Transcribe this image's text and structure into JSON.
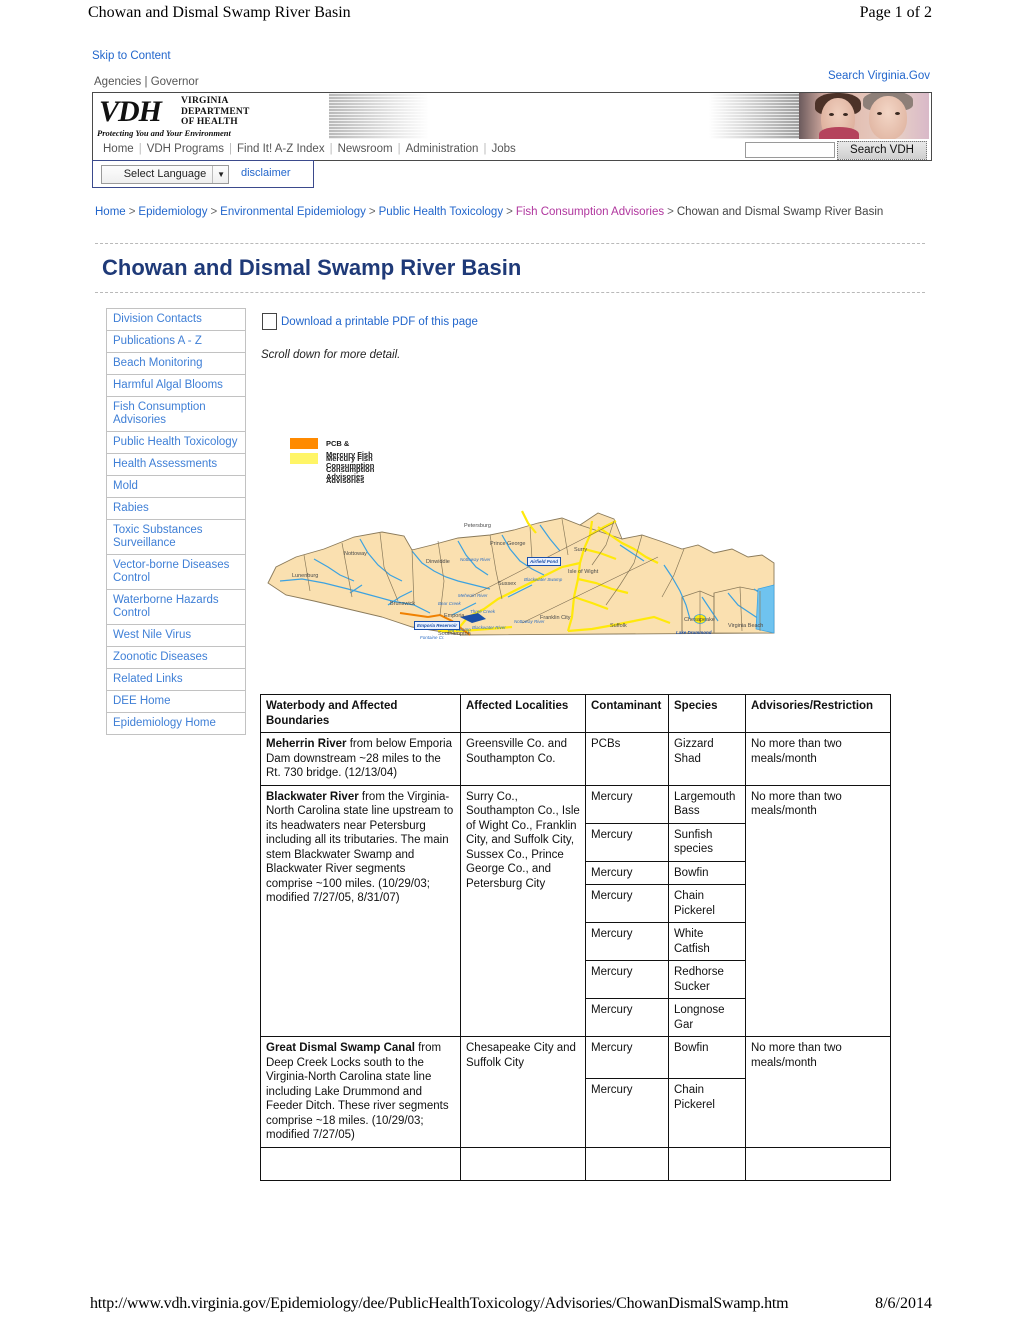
{
  "print": {
    "header_title": "Chowan and Dismal Swamp River Basin",
    "page_indicator": "Page 1 of 2",
    "footer_url": "http://www.vdh.virginia.gov/Epidemiology/dee/PublicHealthToxicology/Advisories/ChowanDismalSwamp.htm",
    "footer_date": "8/6/2014"
  },
  "topbar": {
    "skip_to_content": "Skip to Content",
    "search_virginia": "Search Virginia.Gov",
    "agencies": "Agencies",
    "separator": "|",
    "governor": "Governor"
  },
  "banner": {
    "logo_mark": "VDH",
    "logo_line1": "VIRGINIA",
    "logo_line2": "DEPARTMENT",
    "logo_line3": "OF HEALTH",
    "tagline": "Protecting You and Your Environment"
  },
  "nav": {
    "items": [
      "Home",
      "VDH Programs",
      "Find It! A-Z Index",
      "Newsroom",
      "Administration",
      "Jobs"
    ],
    "search_placeholder": "",
    "search_button": "Search VDH"
  },
  "language": {
    "select_label": "Select Language",
    "caret": "▼",
    "disclaimer": "disclaimer"
  },
  "breadcrumb": {
    "items": [
      {
        "label": "Home",
        "state": "link"
      },
      {
        "label": "Epidemiology",
        "state": "link"
      },
      {
        "label": "Environmental Epidemiology",
        "state": "link"
      },
      {
        "label": "Public Health Toxicology",
        "state": "link"
      },
      {
        "label": "Fish Consumption Advisories",
        "state": "visited"
      },
      {
        "label": "Chowan and Dismal Swamp River Basin",
        "state": "current"
      }
    ],
    "separator": ">"
  },
  "page_title": "Chowan and Dismal Swamp River Basin",
  "sidebar": {
    "items": [
      "Division Contacts",
      "Publications A - Z",
      "Beach Monitoring",
      "Harmful Algal Blooms",
      "Fish Consumption Advisories",
      "Public Health Toxicology",
      "Health Assessments",
      "Mold",
      "Rabies",
      "Toxic Substances Surveillance",
      "Vector-borne Diseases Control",
      "Waterborne Hazards Control",
      "West Nile Virus",
      "Zoonotic Diseases",
      "Related Links",
      "DEE Home",
      "Epidemiology Home"
    ]
  },
  "content": {
    "pdf_link": "Download a printable PDF of this page",
    "scroll_note": "Scroll down for more detail."
  },
  "map": {
    "legend": [
      {
        "color": "#FF8A00",
        "label": "PCB & Mercury Fish Consumption Advisories"
      },
      {
        "color": "#FFF566",
        "label": "Mercury Fish Consumption Advisories"
      }
    ],
    "county_labels": [
      "Lunenburg",
      "Nottoway",
      "Dinwiddie",
      "Brunswick",
      "Emporia",
      "Petersburg",
      "Prince George",
      "Sussex",
      "Surry",
      "Isle of Wight",
      "Franklin City",
      "Southampton",
      "Suffolk",
      "Chesapeake",
      "Virginia Beach"
    ],
    "water_labels": [
      "Nottoway River",
      "Meherrin River",
      "Blackwater River",
      "Bear Creek",
      "Three Creek",
      "Big Swamp",
      "Fontaine Cr.",
      "Nottoway River",
      "Blackwater Swamp"
    ],
    "boxed_labels": [
      "Emporia Reservoir",
      "Airfield Pond",
      "Lake Drummond"
    ],
    "colors": {
      "land": "#FAE0B0",
      "water_blue": "#3CA2E0",
      "advisory_yellow": "#FFE90A",
      "advisory_orange": "#F08000",
      "border": "#8a7a5a"
    }
  },
  "table": {
    "columns": [
      "Waterbody and Affected Boundaries",
      "Affected Localities",
      "Contaminant",
      "Species",
      "Advisories/Restriction"
    ],
    "rows": [
      {
        "waterbody_name": "Meherrin River",
        "waterbody_desc": " from below Emporia Dam downstream ~28 miles to the Rt. 730 bridge. (12/13/04)",
        "localities": "Greensville Co. and Southampton Co.",
        "advisory": "No more than two meals/month",
        "entries": [
          {
            "contaminant": "PCBs",
            "species": "Gizzard Shad"
          }
        ]
      },
      {
        "waterbody_name": "Blackwater River",
        "waterbody_desc": " from the Virginia-North Carolina state line upstream to its headwaters near Petersburg including all its tributaries. The main stem Blackwater Swamp and Blackwater River segments comprise ~100 miles. (10/29/03; modified 7/27/05, 8/31/07)",
        "localities": "Surry Co., Southampton Co., Isle of Wight Co., Franklin City, and Suffolk City, Sussex Co., Prince George Co., and Petersburg City",
        "advisory": "No more than two meals/month",
        "entries": [
          {
            "contaminant": "Mercury",
            "species": "Largemouth Bass"
          },
          {
            "contaminant": "Mercury",
            "species": "Sunfish species"
          },
          {
            "contaminant": "Mercury",
            "species": "Bowfin"
          },
          {
            "contaminant": "Mercury",
            "species": "Chain Pickerel"
          },
          {
            "contaminant": "Mercury",
            "species": "White Catfish"
          },
          {
            "contaminant": "Mercury",
            "species": "Redhorse Sucker"
          },
          {
            "contaminant": "Mercury",
            "species": "Longnose Gar"
          }
        ]
      },
      {
        "waterbody_name": "Great Dismal Swamp Canal",
        "waterbody_desc": " from Deep Creek Locks south to the Virginia-North Carolina state line including Lake Drummond and Feeder Ditch. These river segments comprise ~18 miles. (10/29/03; modified 7/27/05)",
        "localities": "Chesapeake City and Suffolk City",
        "advisory": "No more than two meals/month",
        "entries": [
          {
            "contaminant": "Mercury",
            "species": "Bowfin"
          },
          {
            "contaminant": "Mercury",
            "species": "Chain Pickerel"
          }
        ]
      }
    ]
  }
}
